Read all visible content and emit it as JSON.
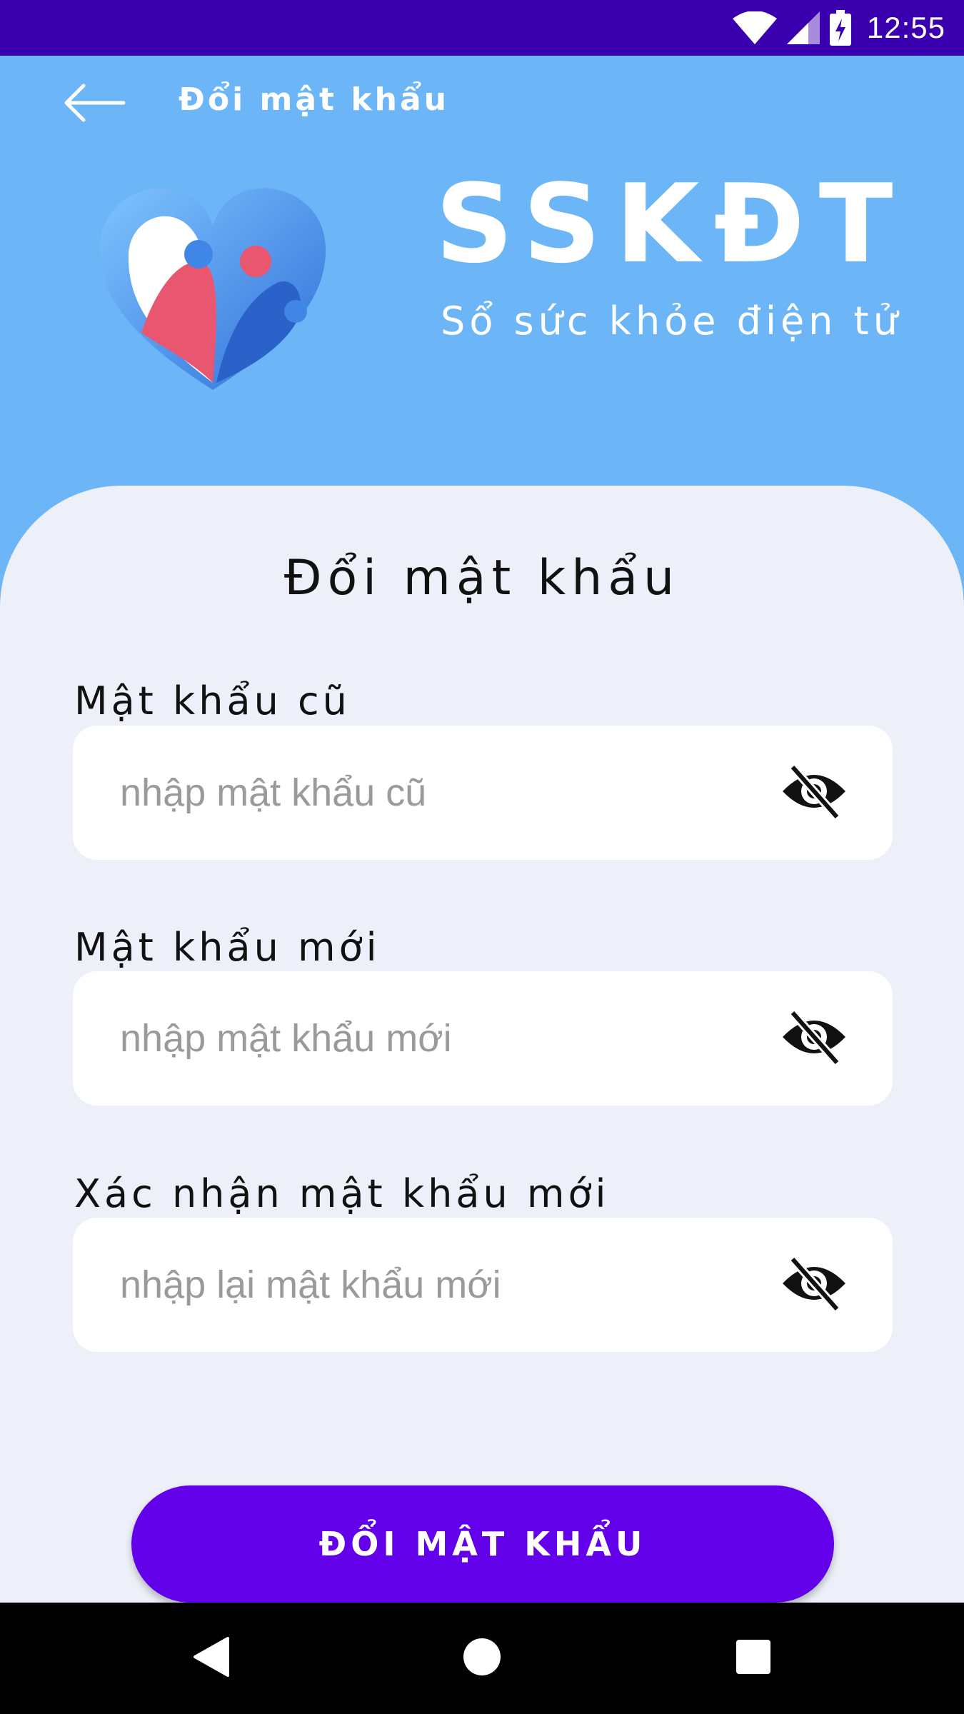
{
  "status_bar": {
    "time": "12:55",
    "icons": [
      "wifi-icon",
      "cellular-signal-icon",
      "battery-charging-icon"
    ],
    "background": "#3a00b0"
  },
  "app_bar": {
    "title": "Đổi mật khẩu",
    "back_icon": "arrow-left-icon"
  },
  "brand": {
    "title": "SSKĐT",
    "subtitle": "Sổ sức khỏe điện tử",
    "logo_icon": "heart-family-logo"
  },
  "form": {
    "title": "Đổi mật khẩu",
    "fields": [
      {
        "label": "Mật khẩu cũ",
        "placeholder": "nhập mật khẩu cũ",
        "value": "",
        "toggle_icon": "eye-off-icon"
      },
      {
        "label": "Mật khẩu mới",
        "placeholder": "nhập mật khẩu mới",
        "value": "",
        "toggle_icon": "eye-off-icon"
      },
      {
        "label": "Xác nhận mật khẩu mới",
        "placeholder": "nhập lại mật khẩu mới",
        "value": "",
        "toggle_icon": "eye-off-icon"
      }
    ],
    "submit_label": "ĐỔI MẬT KHẨU"
  },
  "nav_bar": {
    "icons": [
      "back-triangle-icon",
      "home-circle-icon",
      "recents-square-icon"
    ]
  },
  "colors": {
    "header_bg": "#6cb6f7",
    "card_bg": "#edf0f8",
    "primary": "#6200ea"
  }
}
